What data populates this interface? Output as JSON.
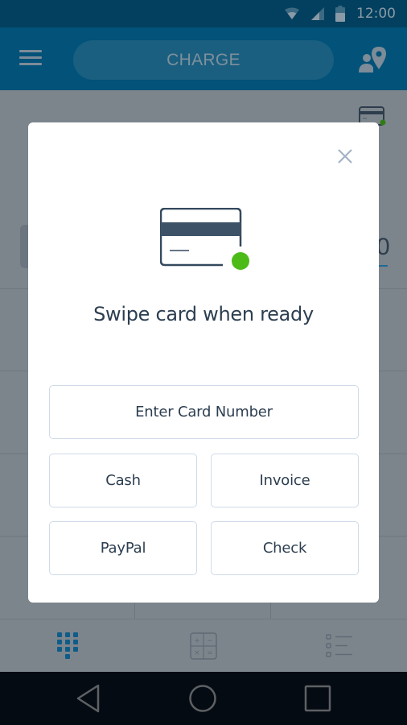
{
  "status_bar": {
    "time": "12:00",
    "icons": [
      "wifi-icon",
      "signal-icon",
      "battery-icon"
    ]
  },
  "header": {
    "menu_icon": "hamburger-menu-icon",
    "charge_label": "CHARGE",
    "customer_icon": "customer-location-icon"
  },
  "background": {
    "card_reader_icon": "card-reader-connected-icon",
    "amount_digit": "0"
  },
  "modal": {
    "close_icon": "close-icon",
    "card_icon": "credit-card-swipe-icon",
    "title": "Swipe card when ready",
    "primary_action": "Enter Card Number",
    "actions": [
      {
        "label": "Cash"
      },
      {
        "label": "Invoice"
      },
      {
        "label": "PayPal"
      },
      {
        "label": "Check"
      }
    ]
  },
  "tabs": [
    {
      "name": "keypad",
      "icon": "keypad-icon",
      "active": true
    },
    {
      "name": "calculator",
      "icon": "calculator-icon",
      "active": false
    },
    {
      "name": "items-list",
      "icon": "list-icon",
      "active": false
    }
  ],
  "nav_bar": {
    "buttons": [
      "back-icon",
      "home-icon",
      "recents-icon"
    ]
  },
  "colors": {
    "accent": "#025279",
    "status_green": "#4cbb17",
    "text_dark": "#2c3e50",
    "active_tab": "#0e5c8a"
  }
}
